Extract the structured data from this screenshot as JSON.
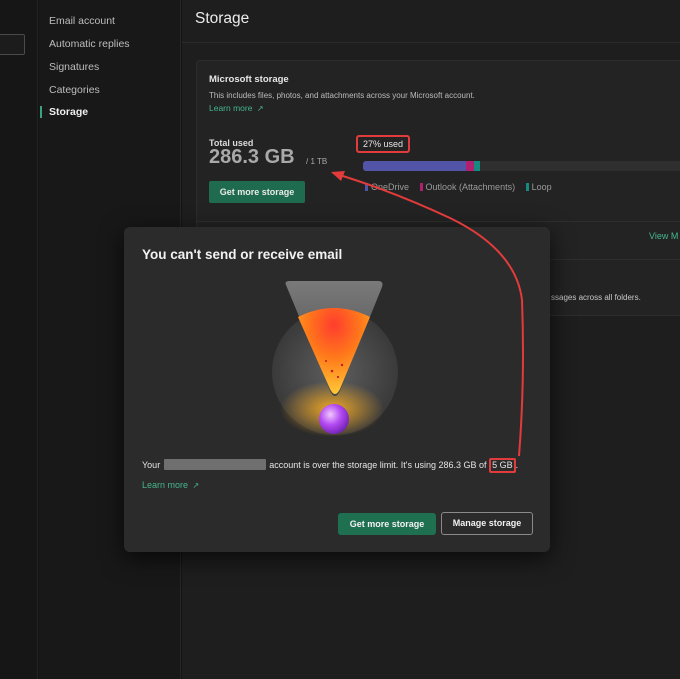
{
  "nav": {
    "items": [
      {
        "label": "Email account"
      },
      {
        "label": "Automatic replies"
      },
      {
        "label": "Signatures"
      },
      {
        "label": "Categories"
      },
      {
        "label": "Storage"
      }
    ]
  },
  "main": {
    "title": "Storage",
    "card": {
      "heading": "Microsoft storage",
      "description": "This includes files, photos, and attachments across your Microsoft account.",
      "learn_more": "Learn more",
      "total_label": "Total used",
      "total_value": "286.3 GB",
      "total_of": "/ 1 TB",
      "get_more": "Get more storage",
      "percent_used": "27% used",
      "usage_fraction": 0.27,
      "segments": [
        {
          "name": "OneDrive",
          "fraction": 0.325,
          "color": "#5254a8"
        },
        {
          "name": "Outlook (Attachments)",
          "fraction": 0.025,
          "color": "#b0206e"
        },
        {
          "name": "Loop",
          "fraction": 0.02,
          "color": "#148a80"
        }
      ],
      "view_more": "View M",
      "folder_text": "ssages across all folders."
    }
  },
  "dialog": {
    "title": "You can't send or receive email",
    "msg_prefix": "Your",
    "msg_middle": "account is over the storage limit. It's using 286.3 GB of",
    "msg_limit": "5 GB",
    "msg_end": ".",
    "learn_more": "Learn more",
    "primary_button": "Get more storage",
    "secondary_button": "Manage storage"
  },
  "colors": {
    "accent": "#1f7051",
    "link": "#46b58d",
    "annotation": "#e23b3b"
  }
}
